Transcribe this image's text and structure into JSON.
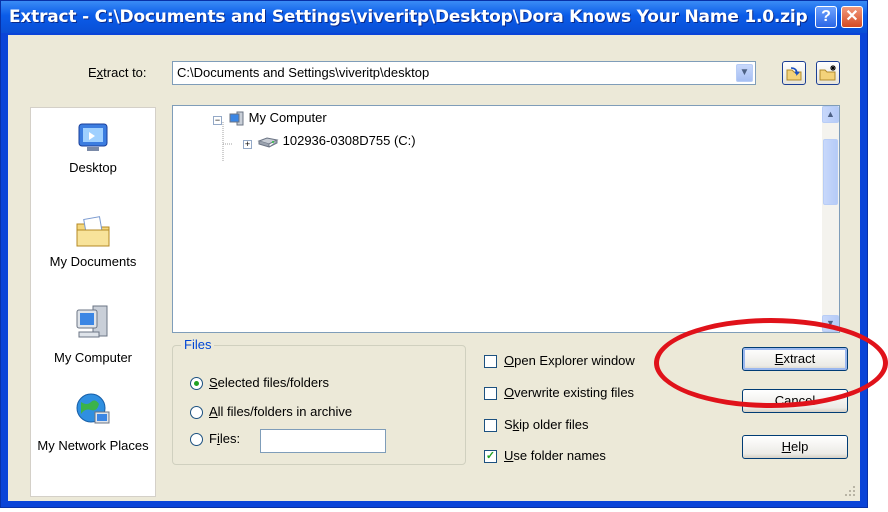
{
  "window": {
    "title": "Extract - C:\\Documents and Settings\\viveritp\\Desktop\\Dora Knows Your Name 1.0.zip",
    "help_glyph": "?",
    "close_glyph": "✕"
  },
  "extract_to": {
    "label_pre": "E",
    "label_key": "x",
    "label_post": "tract to:",
    "value": "C:\\Documents and Settings\\viveritp\\desktop",
    "dropdown_glyph": "▼"
  },
  "places": [
    {
      "label": "Desktop",
      "icon": "desktop-icon"
    },
    {
      "label": "My Documents",
      "icon": "my-documents-icon"
    },
    {
      "label": "My Computer",
      "icon": "my-computer-icon"
    },
    {
      "label": "My Network Places",
      "icon": "my-network-places-icon"
    }
  ],
  "tree": {
    "root": "My Computer",
    "root_expander": "−",
    "child": "102936-0308D755 (C:)",
    "child_expander": "+",
    "scroll_up": "▲",
    "scroll_down": "▼"
  },
  "files_group": {
    "title": "Files",
    "selected": {
      "pre": "",
      "key": "S",
      "post": "elected files/folders",
      "checked": true
    },
    "all": {
      "pre": "",
      "key": "A",
      "post": "ll files/folders in archive",
      "checked": false
    },
    "files": {
      "pre": "F",
      "key": "i",
      "post": "les:",
      "checked": false,
      "value": ""
    }
  },
  "options": {
    "open_explorer": {
      "pre": "",
      "key": "O",
      "post": "pen Explorer window",
      "checked": false
    },
    "overwrite": {
      "pre": "",
      "key": "O",
      "post": "verwrite existing files",
      "checked": false
    },
    "skip_older": {
      "pre": "S",
      "key": "k",
      "post": "ip older files",
      "checked": false
    },
    "use_folder_names": {
      "pre": "",
      "key": "U",
      "post": "se folder names",
      "checked": true,
      "check_glyph": "✓"
    }
  },
  "buttons": {
    "extract": {
      "pre": "",
      "key": "E",
      "post": "xtract"
    },
    "cancel": {
      "label": "Cancel"
    },
    "help": {
      "pre": "",
      "key": "H",
      "post": "elp"
    }
  },
  "colors": {
    "titlebar": "#0a5ce8",
    "client": "#ece9d8",
    "annotation": "#e0121a",
    "group_title": "#0046d5"
  }
}
